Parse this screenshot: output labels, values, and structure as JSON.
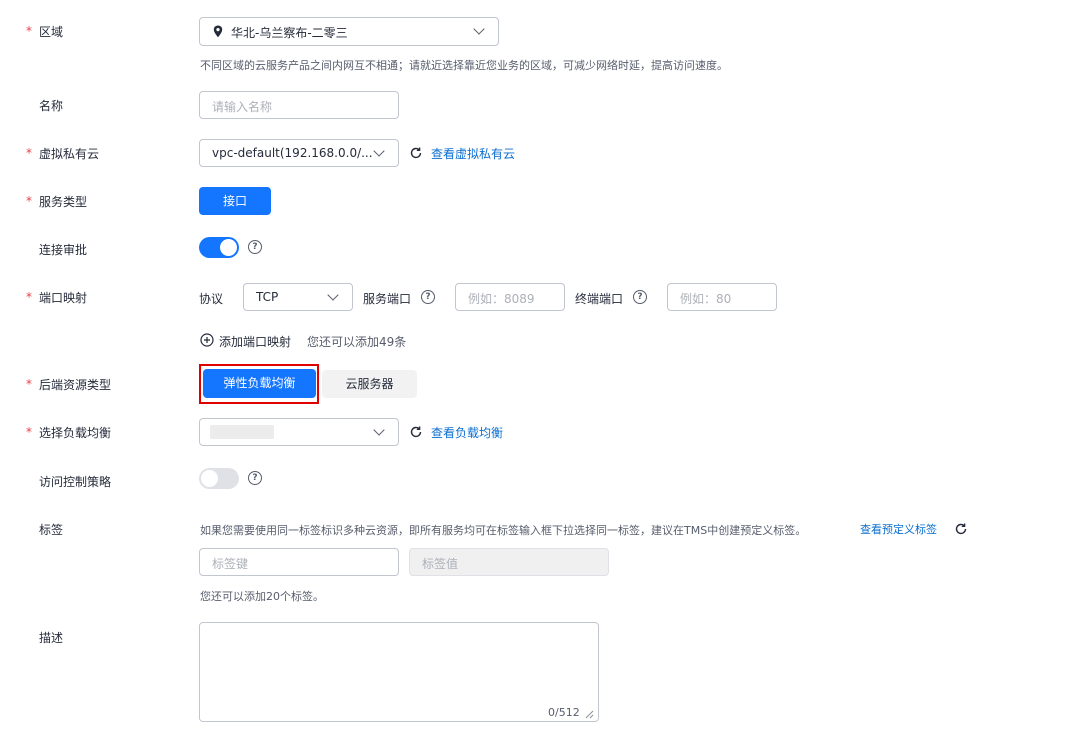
{
  "region": {
    "label": "区域",
    "value": "华北-乌兰察布-二零三",
    "hint": "不同区域的云服务产品之间内网互不相通；请就近选择靠近您业务的区域，可减少网络时延，提高访问速度。"
  },
  "name": {
    "label": "名称",
    "placeholder": "请输入名称"
  },
  "vpc": {
    "label": "虚拟私有云",
    "value": "vpc-default(192.168.0.0/...",
    "link": "查看虚拟私有云"
  },
  "service_type": {
    "label": "服务类型",
    "button": "接口"
  },
  "approval": {
    "label": "连接审批",
    "enabled": true
  },
  "port_mapping": {
    "label": "端口映射",
    "protocol_label": "协议",
    "protocol_value": "TCP",
    "service_port_label": "服务端口",
    "service_port_placeholder": "例如：8089",
    "terminal_port_label": "终端端口",
    "terminal_port_placeholder": "例如：80",
    "add_label": "添加端口映射",
    "remaining": "您还可以添加49条"
  },
  "backend": {
    "label": "后端资源类型",
    "options": [
      "弹性负载均衡",
      "云服务器"
    ],
    "selected": 0
  },
  "lb": {
    "label": "选择负载均衡",
    "link": "查看负载均衡"
  },
  "acl": {
    "label": "访问控制策略",
    "enabled": false
  },
  "tags": {
    "label": "标签",
    "hint": "如果您需要使用同一标签标识多种云资源，即所有服务均可在标签输入框下拉选择同一标签，建议在TMS中创建预定义标签。",
    "link": "查看预定义标签",
    "key_placeholder": "标签键",
    "value_placeholder": "标签值",
    "remaining": "您还可以添加20个标签。"
  },
  "description": {
    "label": "描述",
    "counter": "0/512"
  },
  "colors": {
    "primary": "#1476ff",
    "required": "#e5424d",
    "link": "#0a6ed0",
    "highlight": "#e00000"
  }
}
